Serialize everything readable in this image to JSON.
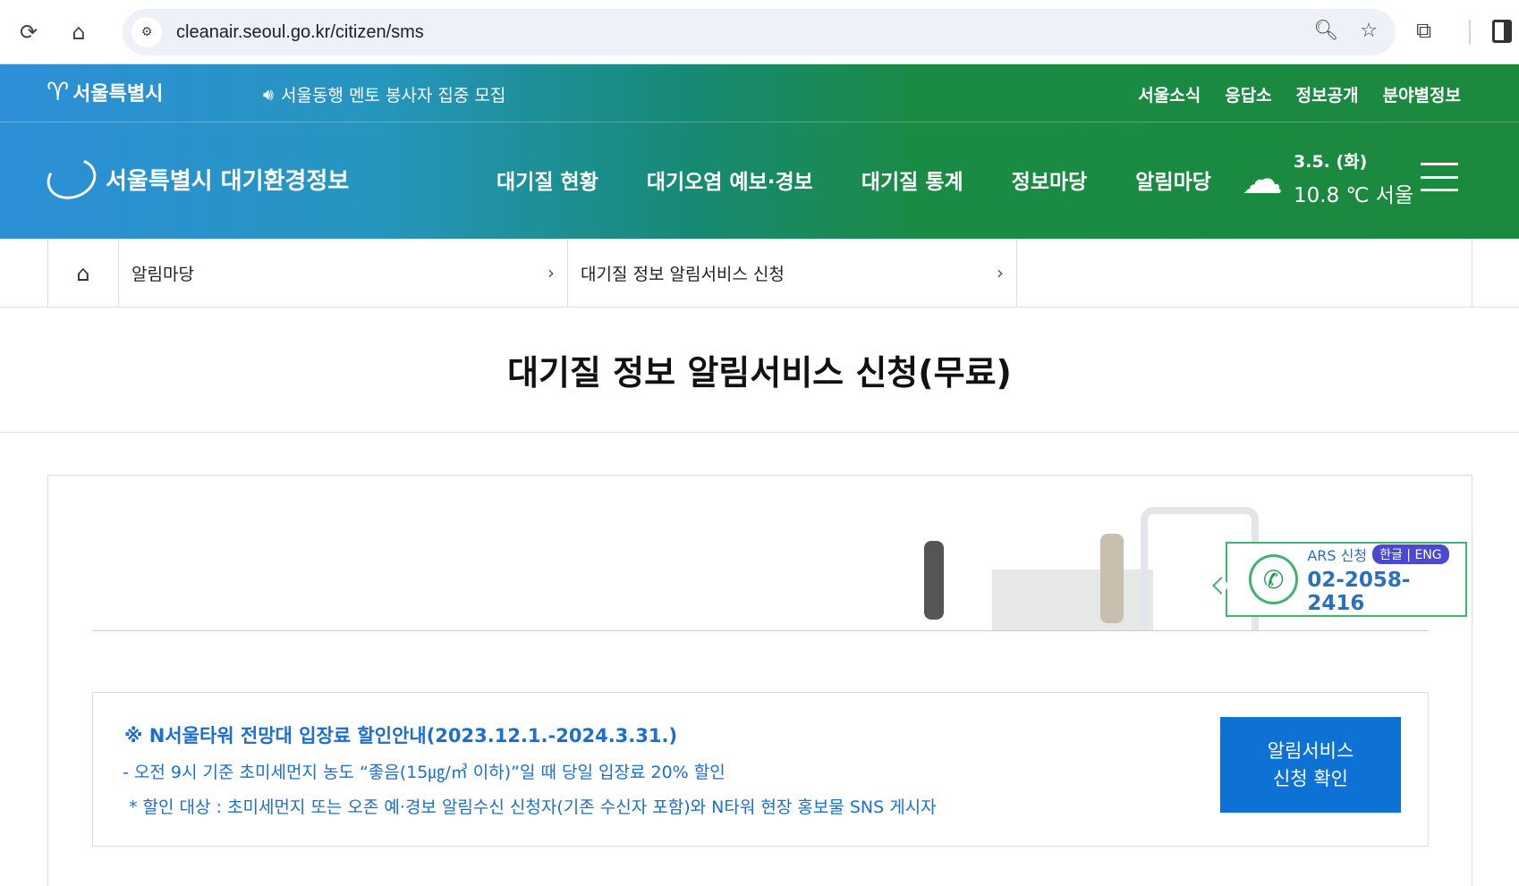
{
  "browser": {
    "url": "cleanair.seoul.go.kr/citizen/sms",
    "reload_icon": "reload-icon",
    "home_icon": "home-icon"
  },
  "header": {
    "seoul_logo": "서울특별시",
    "notice": "서울동행 멘토 봉사자 집중 모집",
    "top_links": [
      "서울소식",
      "응답소",
      "정보공개",
      "분야별정보"
    ],
    "site_title": "서울특별시 대기환경정보",
    "gnb": [
      "대기질 현황",
      "대기오염 예보·경보",
      "대기질 통계",
      "정보마당",
      "알림마당"
    ],
    "weather": {
      "date": "3.5. (화)",
      "temp": "10.8 ℃ 서울"
    }
  },
  "breadcrumb": {
    "level1": "알림마당",
    "level2": "대기질 정보 알림서비스 신청"
  },
  "page_title": "대기질 정보 알림서비스 신청(무료)",
  "ars": {
    "label": "ARS 신청",
    "lang": "한글 | ENG",
    "number": "02-2058-2416"
  },
  "promo": {
    "title": "※ N서울타워 전망대 입장료 할인안내(2023.12.1.-2024.3.31.)",
    "line1": "- 오전 9시 기준 초미세먼지 농도 “좋음(15㎍/㎥ 이하)”일 때 당일 입장료 20% 할인",
    "line2": "* 할인 대상 : 초미세먼지 또는 오존 예·경보 알림수신 신청자(기존 수신자 포함)와 N타워 현장 홍보물 SNS 게시자",
    "button_line1": "알림서비스",
    "button_line2": "신청 확인"
  },
  "colors": {
    "header_blue": "#2d8fd8",
    "header_green": "#1b8a3e",
    "button_blue": "#0d72d4",
    "promo_text": "#1a6fd0",
    "ars_green": "#3fb46d"
  }
}
